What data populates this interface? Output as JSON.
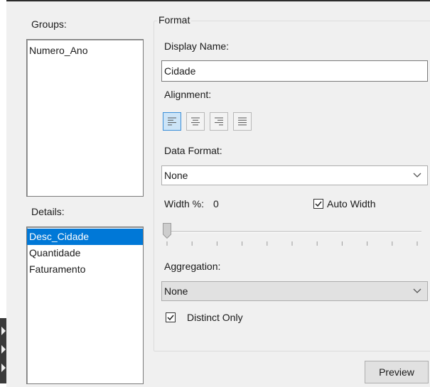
{
  "left": {
    "groups_label": "Groups:",
    "groups": [
      "Numero_Ano"
    ],
    "details_label": "Details:",
    "details": [
      {
        "label": "Desc_Cidade",
        "selected": true
      },
      {
        "label": "Quantidade",
        "selected": false
      },
      {
        "label": "Faturamento",
        "selected": false
      }
    ]
  },
  "format": {
    "title": "Format",
    "display_name_label": "Display Name:",
    "display_name_value": "Cidade",
    "alignment_label": "Alignment:",
    "alignment_options": [
      {
        "icon": "align-left-icon",
        "active": true
      },
      {
        "icon": "align-center-icon",
        "active": false
      },
      {
        "icon": "align-right-icon",
        "active": false
      },
      {
        "icon": "align-justify-icon",
        "active": false
      }
    ],
    "data_format_label": "Data Format:",
    "data_format_value": "None",
    "width_label": "Width %:",
    "width_value": "0",
    "auto_width_label": "Auto Width",
    "auto_width_checked": true,
    "slider_value": 0,
    "aggregation_label": "Aggregation:",
    "aggregation_value": "None",
    "distinct_label": "Distinct Only",
    "distinct_checked": true
  },
  "preview_button": "Preview",
  "colors": {
    "selection": "#0078d7",
    "active_toggle_bg": "#cce4f7",
    "active_toggle_border": "#3c8fd8"
  }
}
